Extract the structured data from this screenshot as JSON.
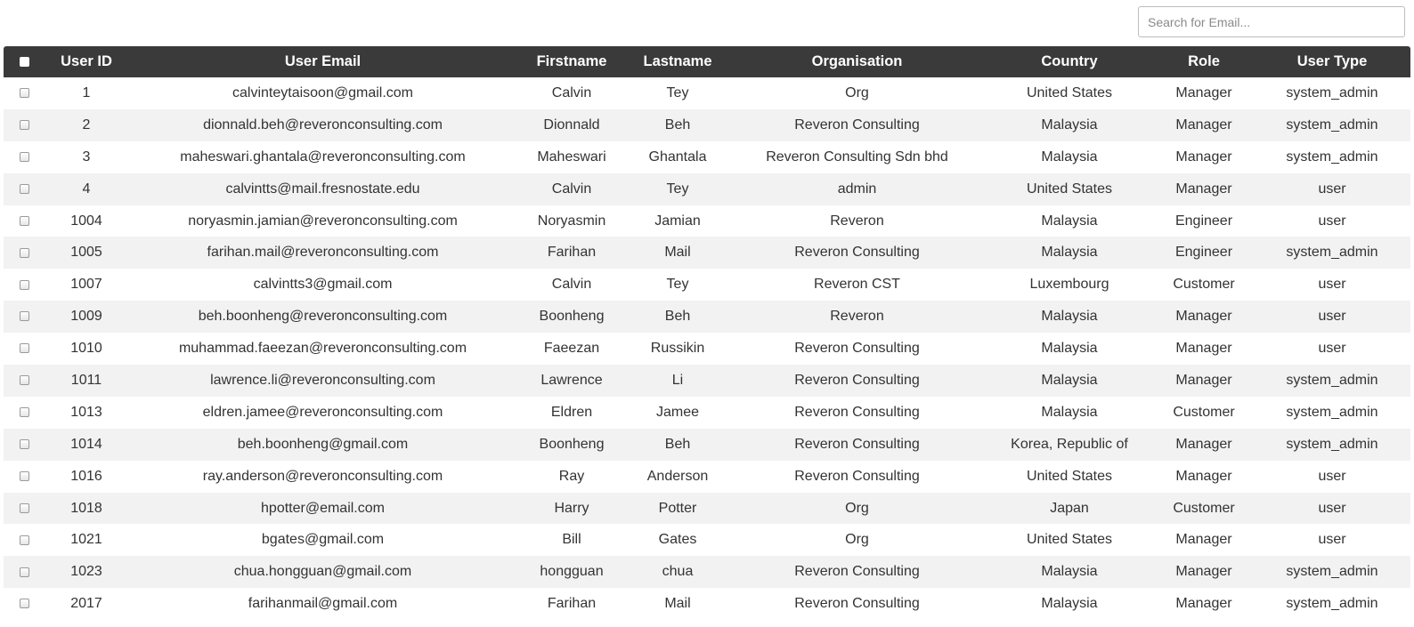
{
  "search": {
    "placeholder": "Search for Email..."
  },
  "table": {
    "columns": [
      "User ID",
      "User Email",
      "Firstname",
      "Lastname",
      "Organisation",
      "Country",
      "Role",
      "User Type"
    ],
    "rows": [
      [
        "1",
        "calvinteytaisoon@gmail.com",
        "Calvin",
        "Tey",
        "Org",
        "United States",
        "Manager",
        "system_admin"
      ],
      [
        "2",
        "dionnald.beh@reveronconsulting.com",
        "Dionnald",
        "Beh",
        "Reveron Consulting",
        "Malaysia",
        "Manager",
        "system_admin"
      ],
      [
        "3",
        "maheswari.ghantala@reveronconsulting.com",
        "Maheswari",
        "Ghantala",
        "Reveron Consulting Sdn bhd",
        "Malaysia",
        "Manager",
        "system_admin"
      ],
      [
        "4",
        "calvintts@mail.fresnostate.edu",
        "Calvin",
        "Tey",
        "admin",
        "United States",
        "Manager",
        "user"
      ],
      [
        "1004",
        "noryasmin.jamian@reveronconsulting.com",
        "Noryasmin",
        "Jamian",
        "Reveron",
        "Malaysia",
        "Engineer",
        "user"
      ],
      [
        "1005",
        "farihan.mail@reveronconsulting.com",
        "Farihan",
        "Mail",
        "Reveron Consulting",
        "Malaysia",
        "Engineer",
        "system_admin"
      ],
      [
        "1007",
        "calvintts3@gmail.com",
        "Calvin",
        "Tey",
        "Reveron CST",
        "Luxembourg",
        "Customer",
        "user"
      ],
      [
        "1009",
        "beh.boonheng@reveronconsulting.com",
        "Boonheng",
        "Beh",
        "Reveron",
        "Malaysia",
        "Manager",
        "user"
      ],
      [
        "1010",
        "muhammad.faeezan@reveronconsulting.com",
        "Faeezan",
        "Russikin",
        "Reveron Consulting",
        "Malaysia",
        "Manager",
        "user"
      ],
      [
        "1011",
        "lawrence.li@reveronconsulting.com",
        "Lawrence",
        "Li",
        "Reveron Consulting",
        "Malaysia",
        "Manager",
        "system_admin"
      ],
      [
        "1013",
        "eldren.jamee@reveronconsulting.com",
        "Eldren",
        "Jamee",
        "Reveron Consulting",
        "Malaysia",
        "Customer",
        "system_admin"
      ],
      [
        "1014",
        "beh.boonheng@gmail.com",
        "Boonheng",
        "Beh",
        "Reveron Consulting",
        "Korea, Republic of",
        "Manager",
        "system_admin"
      ],
      [
        "1016",
        "ray.anderson@reveronconsulting.com",
        "Ray",
        "Anderson",
        "Reveron Consulting",
        "United States",
        "Manager",
        "user"
      ],
      [
        "1018",
        "hpotter@email.com",
        "Harry",
        "Potter",
        "Org",
        "Japan",
        "Customer",
        "user"
      ],
      [
        "1021",
        "bgates@gmail.com",
        "Bill",
        "Gates",
        "Org",
        "United States",
        "Manager",
        "user"
      ],
      [
        "1023",
        "chua.hongguan@gmail.com",
        "hongguan",
        "chua",
        "Reveron Consulting",
        "Malaysia",
        "Manager",
        "system_admin"
      ],
      [
        "2017",
        "farihanmail@gmail.com",
        "Farihan",
        "Mail",
        "Reveron Consulting",
        "Malaysia",
        "Manager",
        "system_admin"
      ]
    ]
  },
  "colors": {
    "header_bg": "#3a3a3a",
    "header_text": "#ffffff",
    "row_alt_bg": "#f2f2f2"
  }
}
